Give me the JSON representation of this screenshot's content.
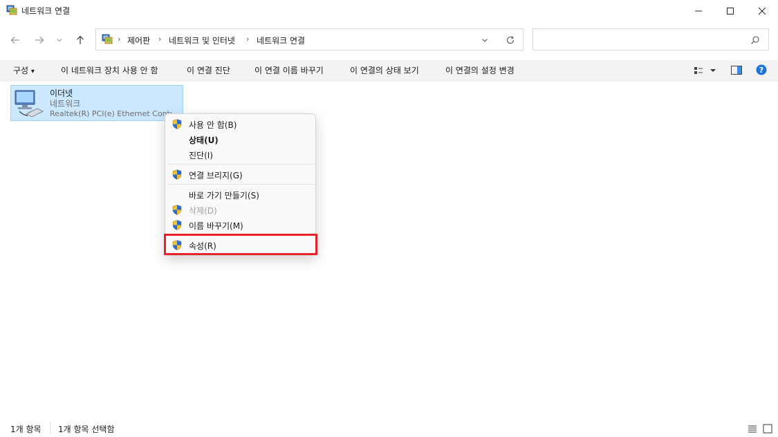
{
  "window": {
    "title": "네트워크 연결",
    "controls": {
      "minimize": "—",
      "maximize": "☐",
      "close": "✕"
    }
  },
  "nav": {
    "back": "←",
    "forward": "→",
    "recent": "⌄",
    "up": "↑"
  },
  "address": {
    "crumbs": [
      "제어판",
      "네트워크 및 인터넷",
      "네트워크 연결"
    ],
    "separator": "›",
    "dropdown": "⌄",
    "refresh": "↻"
  },
  "search": {
    "placeholder": "",
    "icon": "⌕"
  },
  "commands": {
    "organize": "구성",
    "disable": "이 네트워크 장치 사용 안 함",
    "diagnose": "이 연결 진단",
    "rename": "이 연결 이름 바꾸기",
    "status": "이 연결의 상태 보기",
    "settings": "이 연결의 설정 변경",
    "caret": "▾"
  },
  "item": {
    "name": "이더넷",
    "type": "네트워크",
    "device": "Realtek(R) PCI(e) Ethernet Contro"
  },
  "context_menu": {
    "disable": "사용 안 함(B)",
    "status": "상태(U)",
    "diagnose": "진단(I)",
    "bridge": "연결 브리지(G)",
    "shortcut": "바로 가기 만들기(S)",
    "delete": "삭제(D)",
    "rename": "이름 바꾸기(M)",
    "properties": "속성(R)"
  },
  "statusbar": {
    "count": "1개 항목",
    "selected": "1개 항목 선택함"
  },
  "colors": {
    "highlight": "#e8212b",
    "selection": "#cce8ff",
    "help": "#1e73d6"
  }
}
